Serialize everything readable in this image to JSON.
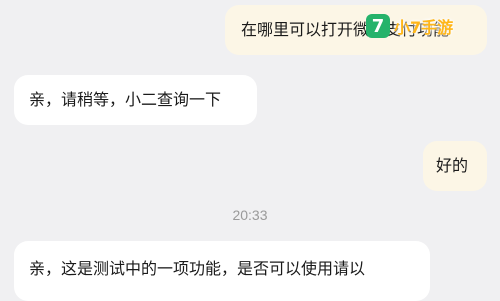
{
  "messages": [
    {
      "side": "right",
      "text": "在哪里可以打开微信支付功能"
    },
    {
      "side": "left",
      "text": "亲，请稍等，小二查询一下"
    },
    {
      "side": "right",
      "text": "好的"
    },
    {
      "side": "left",
      "text": "亲，这是测试中的一项功能，是否可以使用请以"
    }
  ],
  "timestamp": "20:33",
  "watermark": {
    "badge": "7",
    "text": "小7手游"
  },
  "colors": {
    "background": "#f0f0f2",
    "incoming_bubble": "#ffffff",
    "outgoing_bubble": "#fcf6e6",
    "watermark_green": "#25b36b",
    "watermark_orange": "#ffb619"
  }
}
